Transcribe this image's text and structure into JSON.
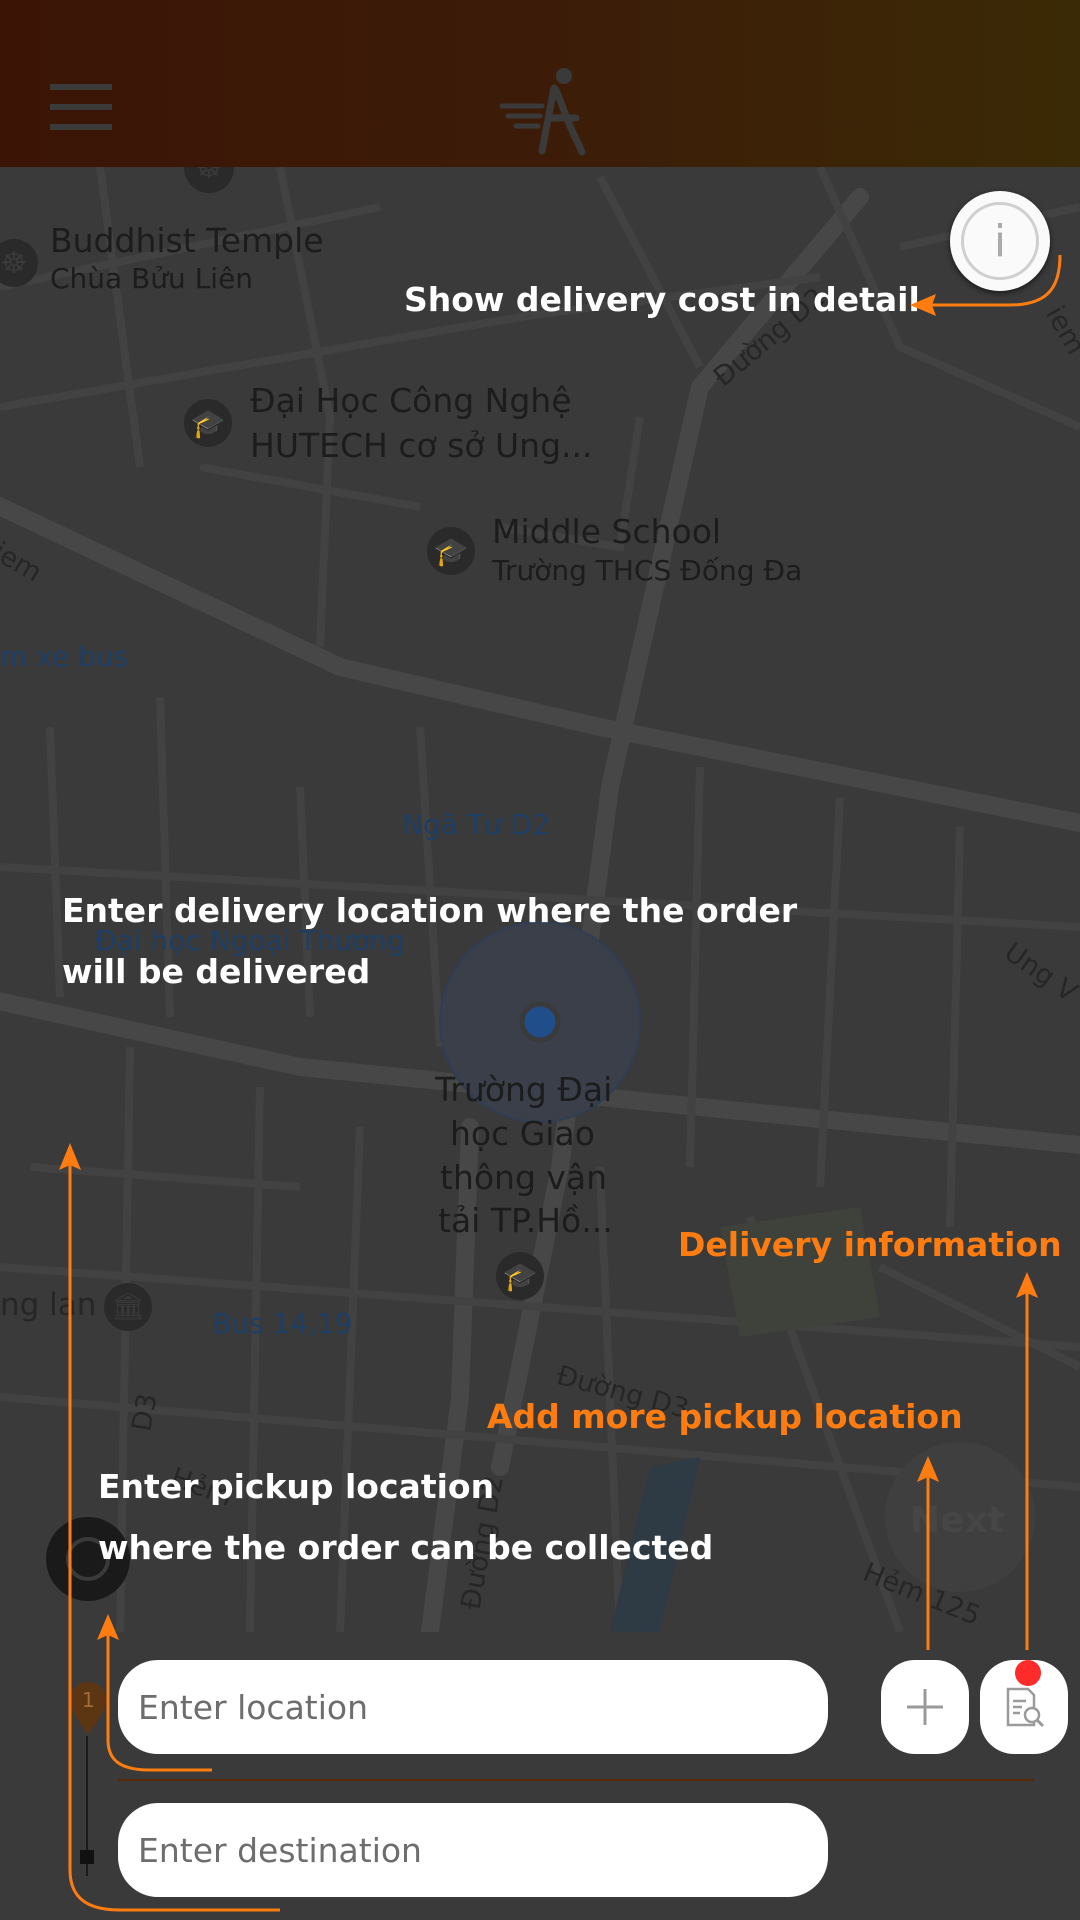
{
  "colors": {
    "accent": "#ff7d10",
    "header_left": "#3b1406",
    "header_right": "#3b2a06",
    "badge": "#ff2a2a"
  },
  "header": {
    "menu_icon": "hamburger-icon",
    "logo_icon": "runner-logo-icon"
  },
  "info_button": {
    "icon": "info-icon",
    "glyph": "i"
  },
  "map": {
    "pois": [
      {
        "title": "Buddhist Temple",
        "subtitle": "Chùa Bửu Liên"
      },
      {
        "title": "Đại Học Công Nghệ",
        "subtitle": "HUTECH cơ sở Ung..."
      },
      {
        "title": "Middle School",
        "subtitle": "Trường THCS Đống Đa"
      },
      {
        "title": "Trường Đại",
        "subtitle": "học Giao",
        "line3": "thông vận",
        "line4": "tải TP.Hồ..."
      }
    ],
    "transit": [
      "m xe bus",
      "Ngã Tư D2",
      "Đại học Ngoại Thương",
      "Bus 14,19"
    ],
    "streets": [
      "Đường D2",
      "iem",
      "Ung V",
      "ng lan",
      "Đường D3",
      "D3",
      "Hẻm",
      "Đường D2",
      "Hẻm 125",
      "iem"
    ]
  },
  "next_button": {
    "label": "Next"
  },
  "annotations": {
    "cost_detail": "Show delivery cost in detail",
    "delivery_line1": "Enter delivery location where the order",
    "delivery_line2": "will be delivered",
    "delivery_info": "Delivery information",
    "add_pickup": "Add more pickup location",
    "pickup_line1": "Enter pickup location",
    "pickup_line2": "where the order can be collected"
  },
  "form": {
    "pickup_marker": "1",
    "location_placeholder": "Enter location",
    "destination_placeholder": "Enter destination",
    "add_icon": "plus-icon",
    "details_icon": "document-search-icon"
  }
}
